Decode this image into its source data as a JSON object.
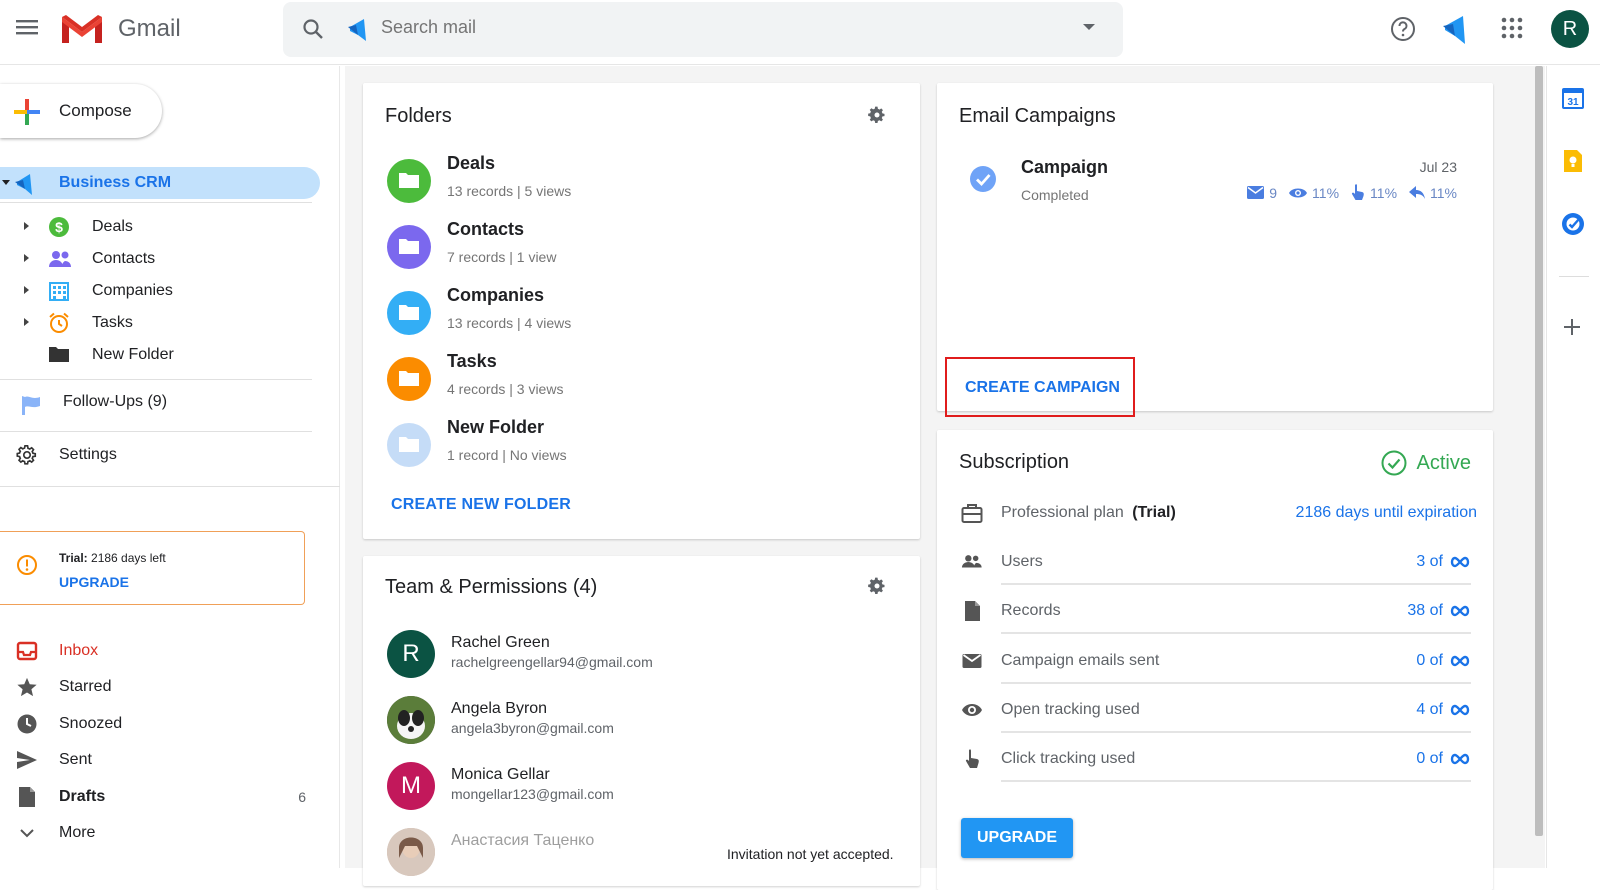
{
  "header": {
    "app_name": "Gmail",
    "search_placeholder": "Search mail",
    "avatar_initial": "R"
  },
  "sidebar": {
    "compose_label": "Compose",
    "crm_label": "Business CRM",
    "crm_items": [
      {
        "label": "Deals",
        "icon": "dollar-icon"
      },
      {
        "label": "Contacts",
        "icon": "people-icon"
      },
      {
        "label": "Companies",
        "icon": "building-icon"
      },
      {
        "label": "Tasks",
        "icon": "alarm-icon"
      },
      {
        "label": "New Folder",
        "icon": "folder-icon"
      }
    ],
    "followups_label": "Follow-Ups (9)",
    "settings_label": "Settings",
    "trial": {
      "bold": "Trial:",
      "text": "2186 days left",
      "upgrade": "UPGRADE"
    },
    "mail_nav": [
      {
        "label": "Inbox",
        "icon": "inbox-icon",
        "count": ""
      },
      {
        "label": "Starred",
        "icon": "star-icon",
        "count": ""
      },
      {
        "label": "Snoozed",
        "icon": "clock-icon",
        "count": ""
      },
      {
        "label": "Sent",
        "icon": "send-icon",
        "count": ""
      },
      {
        "label": "Drafts",
        "icon": "draft-icon",
        "count": "6"
      },
      {
        "label": "More",
        "icon": "chevron-down-icon",
        "count": ""
      }
    ]
  },
  "folders": {
    "title": "Folders",
    "items": [
      {
        "name": "Deals",
        "meta": "13 records | 5 views",
        "color": "#4cbb3c"
      },
      {
        "name": "Contacts",
        "meta": "7 records | 1 view",
        "color": "#7b68ee"
      },
      {
        "name": "Companies",
        "meta": "13 records | 4 views",
        "color": "#33aef5"
      },
      {
        "name": "Tasks",
        "meta": "4 records | 3 views",
        "color": "#fb8c00"
      },
      {
        "name": "New Folder",
        "meta": "1 record | No views",
        "color": "#c5dcf7"
      }
    ],
    "create_label": "CREATE NEW FOLDER"
  },
  "team": {
    "title": "Team & Permissions (4)",
    "members": [
      {
        "initial": "R",
        "name": "Rachel Green",
        "email": "rachelgreengellar94@gmail.com",
        "color": "#0b5343",
        "note": ""
      },
      {
        "initial": "",
        "name": "Angela Byron",
        "email": "angela3byron@gmail.com",
        "color": "#3a3a3a",
        "note": ""
      },
      {
        "initial": "M",
        "name": "Monica Gellar",
        "email": "mongellar123@gmail.com",
        "color": "#c2185b",
        "note": ""
      },
      {
        "initial": "",
        "name": "Анастасия Таценко",
        "email": "",
        "color": "#b89a8a",
        "note": "Invitation not yet accepted."
      }
    ]
  },
  "campaigns": {
    "title": "Email Campaigns",
    "campaign": {
      "name": "Campaign",
      "status": "Completed",
      "date": "Jul 23",
      "stats": {
        "sent": "9",
        "opens": "11%",
        "clicks": "11%",
        "replies": "11%"
      }
    },
    "create_label": "CREATE CAMPAIGN"
  },
  "subscription": {
    "title": "Subscription",
    "status": "Active",
    "plan_label": "Professional plan",
    "plan_tag": "(Trial)",
    "expiration": "2186 days until expiration",
    "rows": [
      {
        "label": "Users",
        "value": "3 of",
        "icon": "users-icon"
      },
      {
        "label": "Records",
        "value": "38 of",
        "icon": "file-icon"
      },
      {
        "label": "Campaign emails sent",
        "value": "0 of",
        "icon": "mail-icon"
      },
      {
        "label": "Open tracking used",
        "value": "4 of",
        "icon": "eye-icon"
      },
      {
        "label": "Click tracking used",
        "value": "0 of",
        "icon": "pointer-icon"
      }
    ],
    "upgrade_label": "UPGRADE"
  },
  "side_panel": {
    "calendar_day": "31"
  }
}
